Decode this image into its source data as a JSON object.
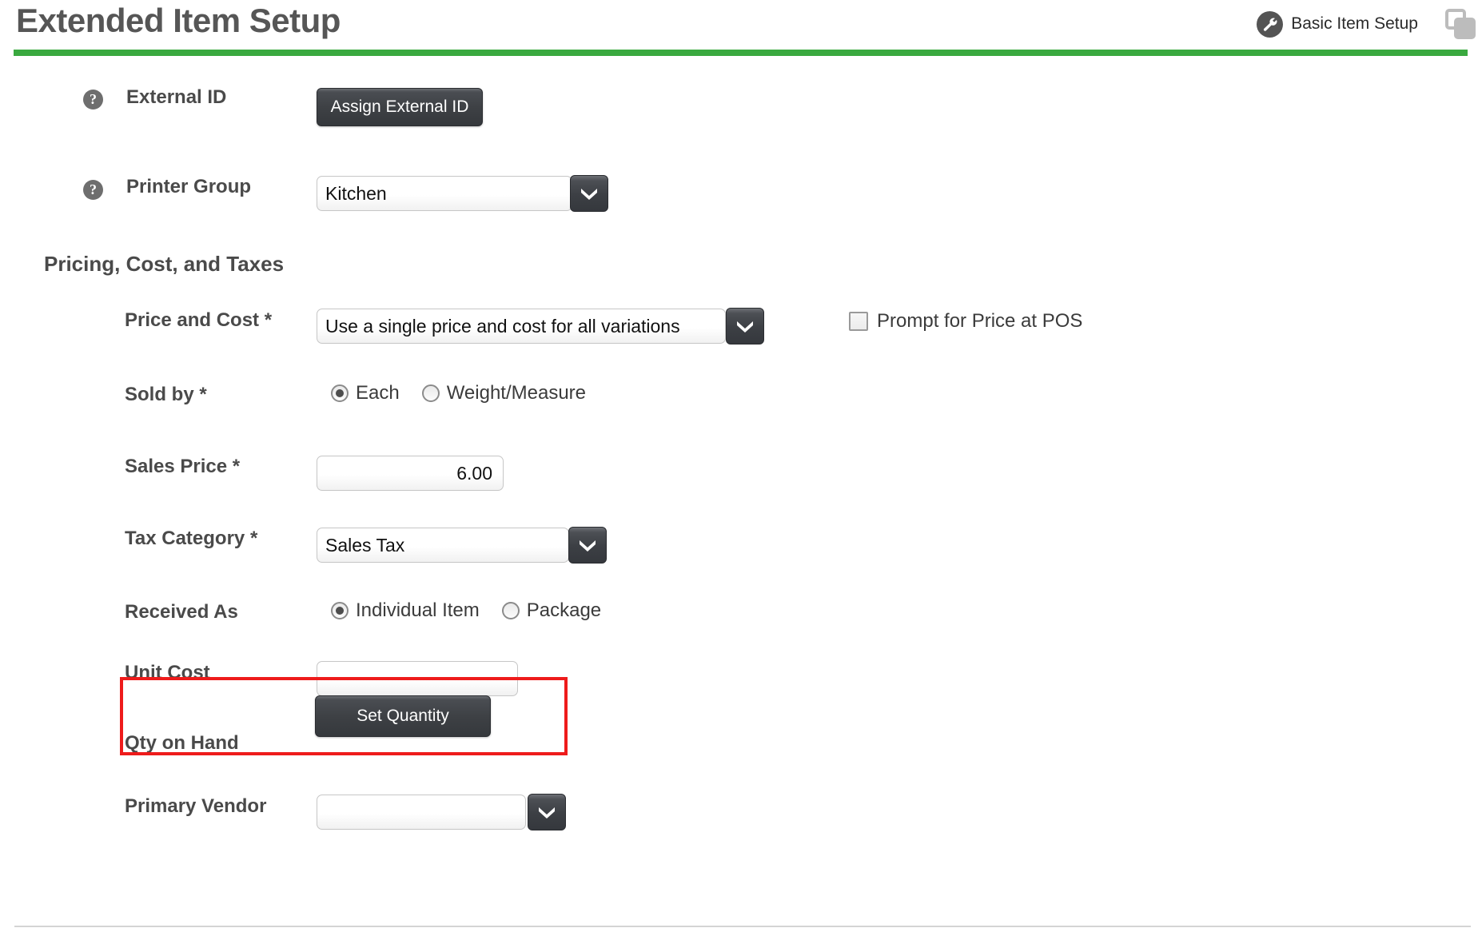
{
  "header": {
    "title": "Extended Item Setup",
    "wrench_icon": "wrench-icon",
    "basic_item_setup_label": "Basic Item Setup",
    "copy_icon": "copy-icon",
    "accent_color": "#3aa93f"
  },
  "form": {
    "help_glyph": "?",
    "external_id": {
      "label": "External ID",
      "button_label": "Assign External ID"
    },
    "printer_group": {
      "label": "Printer Group",
      "value": "Kitchen"
    },
    "section_heading": "Pricing, Cost, and Taxes",
    "price_and_cost": {
      "label": "Price and Cost *",
      "value": "Use a single price and cost for all variations"
    },
    "prompt_for_price": {
      "label": "Prompt for Price at POS",
      "checked": false
    },
    "sold_by": {
      "label": "Sold by *",
      "options": [
        {
          "label": "Each",
          "selected": true
        },
        {
          "label": "Weight/Measure",
          "selected": false
        }
      ]
    },
    "sales_price": {
      "label": "Sales Price *",
      "value": "6.00"
    },
    "tax_category": {
      "label": "Tax Category *",
      "value": "Sales Tax"
    },
    "received_as": {
      "label": "Received As",
      "options": [
        {
          "label": "Individual Item",
          "selected": true
        },
        {
          "label": "Package",
          "selected": false
        }
      ]
    },
    "unit_cost": {
      "label": "Unit Cost",
      "value": ""
    },
    "qty_on_hand": {
      "label": "Qty on Hand",
      "button_label": "Set Quantity",
      "highlight_color": "#ee1b1b"
    },
    "primary_vendor": {
      "label": "Primary Vendor",
      "value": ""
    }
  }
}
